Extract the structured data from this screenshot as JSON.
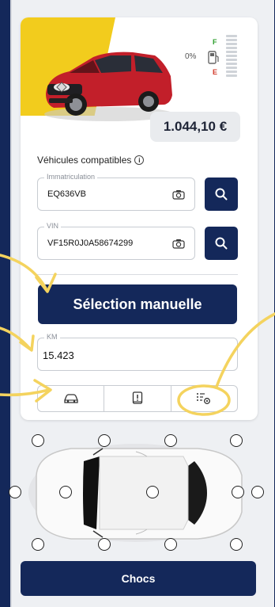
{
  "vehicle": {
    "fuel_percent": "0%",
    "fuel_full": "F",
    "fuel_empty": "E",
    "price": "1.044,10 €"
  },
  "compat": {
    "label": "Véhicules compatibles",
    "info_icon": "ⓘ"
  },
  "registration": {
    "legend": "Immatriculation",
    "value": "EQ636VB"
  },
  "vin": {
    "legend": "VIN",
    "value": "VF15R0J0A58674299"
  },
  "buttons": {
    "manual": "Sélection manuelle",
    "chocs": "Chocs"
  },
  "km": {
    "legend": "KM",
    "value": "15.423"
  },
  "icons": {
    "tab_vehicle": "car-icon",
    "tab_manual": "book-alert-icon",
    "tab_settings": "list-settings-icon",
    "camera": "camera-icon",
    "search": "search-icon"
  },
  "colors": {
    "primary": "#14285a",
    "accent_yellow": "#f2cc1d",
    "annotation": "#f4d35e"
  }
}
